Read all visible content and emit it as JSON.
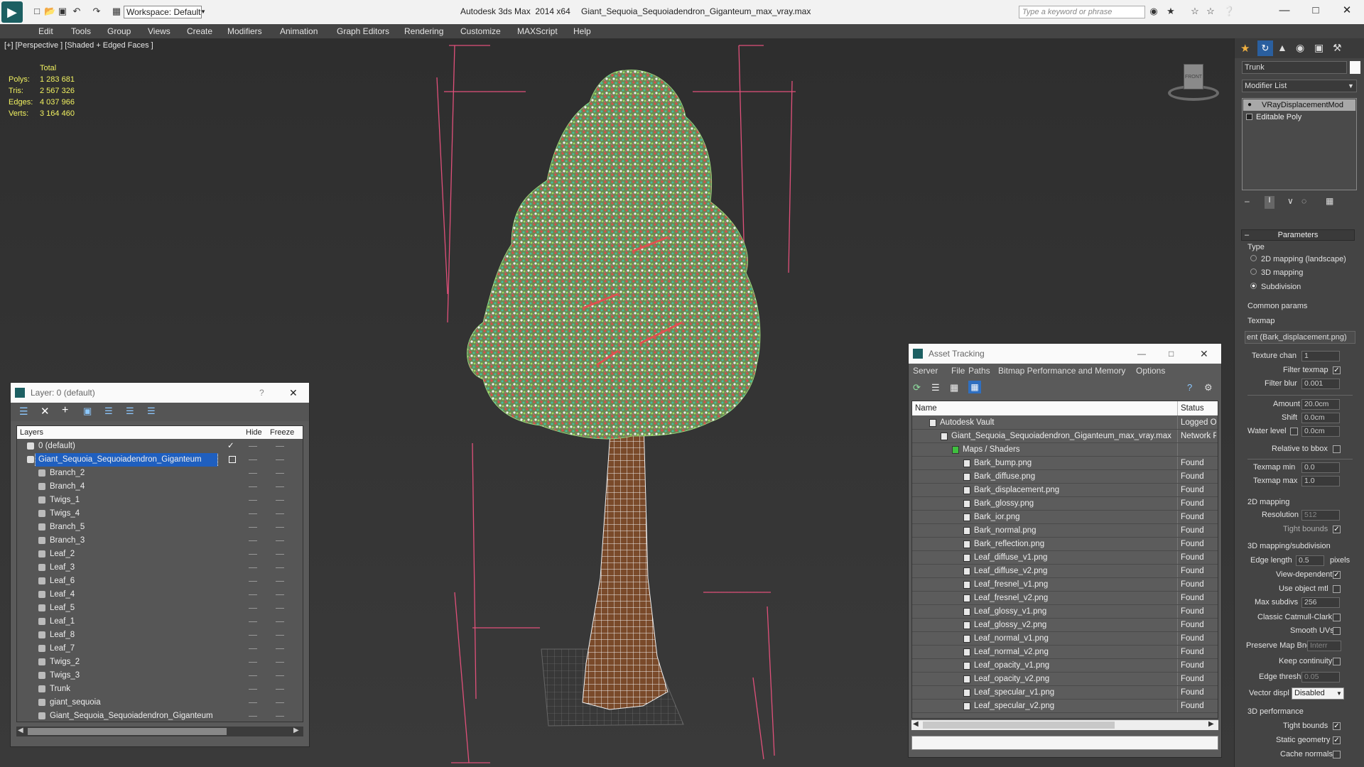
{
  "titlebar": {
    "app_title": "Autodesk 3ds Max  2014 x64",
    "file_title": "Giant_Sequoia_Sequoiadendron_Giganteum_max_vray.max",
    "workspace": "Workspace: Default",
    "search_placeholder": "Type a keyword or phrase"
  },
  "menu": [
    "Edit",
    "Tools",
    "Group",
    "Views",
    "Create",
    "Modifiers",
    "Animation",
    "Graph Editors",
    "Rendering",
    "Customize",
    "MAXScript",
    "Help"
  ],
  "viewport": {
    "label": "[+] [Perspective ] [Shaded + Edged Faces ]",
    "stats_header": "Total",
    "stats": [
      {
        "label": "Polys:",
        "value": "1 283 681"
      },
      {
        "label": "Tris:",
        "value": "2 567 326"
      },
      {
        "label": "Edges:",
        "value": "4 037 966"
      },
      {
        "label": "Verts:",
        "value": "3 164 460"
      }
    ],
    "viewcube_label": "FRONT"
  },
  "layer_panel": {
    "title": "Layer: 0 (default)",
    "help": "?",
    "col_layers": "Layers",
    "col_hide": "Hide",
    "col_freeze": "Freeze",
    "rows": [
      {
        "name": "0 (default)",
        "level": 1,
        "checked": true
      },
      {
        "name": "Giant_Sequoia_Sequoiadendron_Giganteum",
        "level": 1,
        "selected": true
      },
      {
        "name": "Branch_2",
        "level": 2
      },
      {
        "name": "Branch_4",
        "level": 2
      },
      {
        "name": "Twigs_1",
        "level": 2
      },
      {
        "name": "Twigs_4",
        "level": 2
      },
      {
        "name": "Branch_5",
        "level": 2
      },
      {
        "name": "Branch_3",
        "level": 2
      },
      {
        "name": "Leaf_2",
        "level": 2
      },
      {
        "name": "Leaf_3",
        "level": 2
      },
      {
        "name": "Leaf_6",
        "level": 2
      },
      {
        "name": "Leaf_4",
        "level": 2
      },
      {
        "name": "Leaf_5",
        "level": 2
      },
      {
        "name": "Leaf_1",
        "level": 2
      },
      {
        "name": "Leaf_8",
        "level": 2
      },
      {
        "name": "Leaf_7",
        "level": 2
      },
      {
        "name": "Twigs_2",
        "level": 2
      },
      {
        "name": "Twigs_3",
        "level": 2
      },
      {
        "name": "Trunk",
        "level": 2
      },
      {
        "name": "giant_sequoia",
        "level": 2
      },
      {
        "name": "Giant_Sequoia_Sequoiadendron_Giganteum",
        "level": 2
      }
    ]
  },
  "asset_panel": {
    "title": "Asset Tracking",
    "menu": [
      "Server",
      "File",
      "Paths",
      "Bitmap Performance and Memory",
      "Options"
    ],
    "col_name": "Name",
    "col_status": "Status",
    "rows": [
      {
        "name": "Autodesk Vault",
        "status": "Logged Ou",
        "level": 0
      },
      {
        "name": "Giant_Sequoia_Sequoiadendron_Giganteum_max_vray.max",
        "status": "Network P",
        "level": 1
      },
      {
        "name": "Maps / Shaders",
        "status": "",
        "level": 2
      },
      {
        "name": "Bark_bump.png",
        "status": "Found",
        "level": 3
      },
      {
        "name": "Bark_diffuse.png",
        "status": "Found",
        "level": 3
      },
      {
        "name": "Bark_displacement.png",
        "status": "Found",
        "level": 3
      },
      {
        "name": "Bark_glossy.png",
        "status": "Found",
        "level": 3
      },
      {
        "name": "Bark_ior.png",
        "status": "Found",
        "level": 3
      },
      {
        "name": "Bark_normal.png",
        "status": "Found",
        "level": 3
      },
      {
        "name": "Bark_reflection.png",
        "status": "Found",
        "level": 3
      },
      {
        "name": "Leaf_diffuse_v1.png",
        "status": "Found",
        "level": 3
      },
      {
        "name": "Leaf_diffuse_v2.png",
        "status": "Found",
        "level": 3
      },
      {
        "name": "Leaf_fresnel_v1.png",
        "status": "Found",
        "level": 3
      },
      {
        "name": "Leaf_fresnel_v2.png",
        "status": "Found",
        "level": 3
      },
      {
        "name": "Leaf_glossy_v1.png",
        "status": "Found",
        "level": 3
      },
      {
        "name": "Leaf_glossy_v2.png",
        "status": "Found",
        "level": 3
      },
      {
        "name": "Leaf_normal_v1.png",
        "status": "Found",
        "level": 3
      },
      {
        "name": "Leaf_normal_v2.png",
        "status": "Found",
        "level": 3
      },
      {
        "name": "Leaf_opacity_v1.png",
        "status": "Found",
        "level": 3
      },
      {
        "name": "Leaf_opacity_v2.png",
        "status": "Found",
        "level": 3
      },
      {
        "name": "Leaf_specular_v1.png",
        "status": "Found",
        "level": 3
      },
      {
        "name": "Leaf_specular_v2.png",
        "status": "Found",
        "level": 3
      }
    ]
  },
  "right_panel": {
    "object_name": "Trunk",
    "modifier_list": "Modifier List",
    "stack": [
      "VRayDisplacementMod",
      "Editable Poly"
    ],
    "parameters_header": "Parameters",
    "type_label": "Type",
    "type_options": [
      "2D mapping (landscape)",
      "3D mapping",
      "Subdivision"
    ],
    "type_selected": 2,
    "common_params": "Common params",
    "texmap_label": "Texmap",
    "texmap_value": "ent (Bark_displacement.png)",
    "texture_chan_label": "Texture chan",
    "texture_chan": "1",
    "filter_texmap": "Filter texmap",
    "filter_blur_label": "Filter blur",
    "filter_blur": "0.001",
    "amount_label": "Amount",
    "amount": "20.0cm",
    "shift_label": "Shift",
    "shift": "0.0cm",
    "water_level_label": "Water level",
    "water_level": "0.0cm",
    "relative_bbox": "Relative to bbox",
    "texmap_min_label": "Texmap min",
    "texmap_min": "0.0",
    "texmap_max_label": "Texmap max",
    "texmap_max": "1.0",
    "mapping2d_header": "2D mapping",
    "resolution_label": "Resolution",
    "resolution": "512",
    "tight_bounds": "Tight bounds",
    "mapping3d_header": "3D mapping/subdivision",
    "edge_length_label": "Edge length",
    "edge_length": "0.5",
    "pixels": "pixels",
    "view_dependent": "View-dependent",
    "use_object_mtl": "Use object mtl",
    "max_subdivs_label": "Max subdivs",
    "max_subdivs": "256",
    "classic_catmull": "Classic Catmull-Clark",
    "smooth_uvs": "Smooth UVs",
    "preserve_map_bnd": "Preserve Map Bnd",
    "preserve_value": "Interr",
    "keep_continuity": "Keep continuity",
    "edge_thresh_label": "Edge thresh",
    "edge_thresh": "0.05",
    "vector_displ_label": "Vector displ",
    "vector_displ": "Disabled",
    "perf_header": "3D performance",
    "perf_tight_bounds": "Tight bounds",
    "static_geometry": "Static geometry",
    "cache_normals": "Cache normals"
  },
  "colors": {
    "accent": "#1e6fd0",
    "selection": "#1f5fbf",
    "stats": "#f0f060",
    "bbox": "#e0507a"
  }
}
